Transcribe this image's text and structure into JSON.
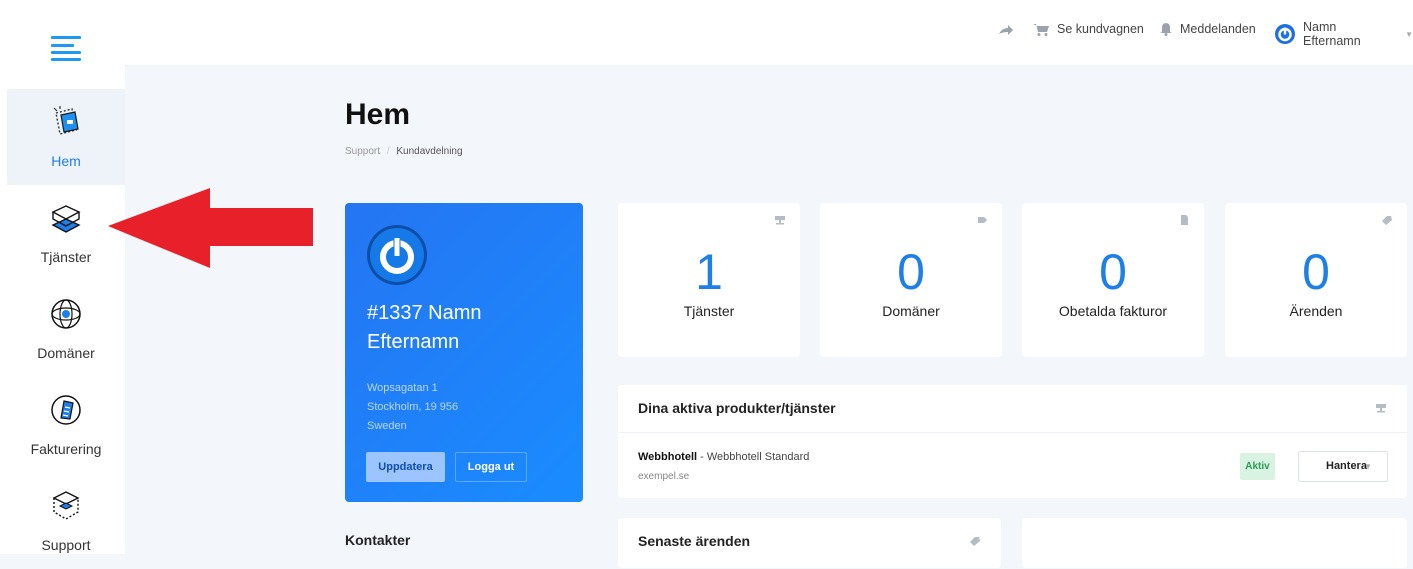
{
  "sidebar": {
    "items": [
      {
        "label": "Hem",
        "icon": "home-icon",
        "active": true
      },
      {
        "label": "Tjänster",
        "icon": "services-icon"
      },
      {
        "label": "Domäner",
        "icon": "globe-icon"
      },
      {
        "label": "Fakturering",
        "icon": "billing-icon"
      },
      {
        "label": "Support",
        "icon": "support-icon"
      }
    ]
  },
  "topbar": {
    "share_icon": "share-icon",
    "cart_label": "Se kundvagnen",
    "messages_label": "Meddelanden",
    "user_label": "Namn Efternamn"
  },
  "page": {
    "title": "Hem",
    "breadcrumb": {
      "parent": "Support",
      "separator": "/",
      "current": "Kundavdelning"
    }
  },
  "profile": {
    "name": "#1337 Namn Efternamn",
    "address": [
      "Wopsagatan 1",
      "Stockholm, 19 956",
      "Sweden"
    ],
    "update_label": "Uppdatera",
    "logout_label": "Logga ut"
  },
  "stats": [
    {
      "value": "1",
      "label": "Tjänster",
      "icon": "server-icon"
    },
    {
      "value": "0",
      "label": "Domäner",
      "icon": "tag-icon"
    },
    {
      "value": "0",
      "label": "Obetalda fakturor",
      "icon": "document-icon"
    },
    {
      "value": "0",
      "label": "Ärenden",
      "icon": "comment-icon"
    }
  ],
  "active_products": {
    "title": "Dina aktiva produkter/tjänster",
    "product_name": "Webbhotell",
    "product_detail": " - Webbhotell Standard",
    "domain": "exempel.se",
    "status": "Aktiv",
    "manage_label": "Hantera"
  },
  "recent_tickets": {
    "title": "Senaste ärenden"
  },
  "contacts": {
    "title": "Kontakter"
  },
  "colors": {
    "accent": "#1f7fe8",
    "active_badge": "#d8f3e1",
    "annotation_arrow": "#e8202a"
  }
}
